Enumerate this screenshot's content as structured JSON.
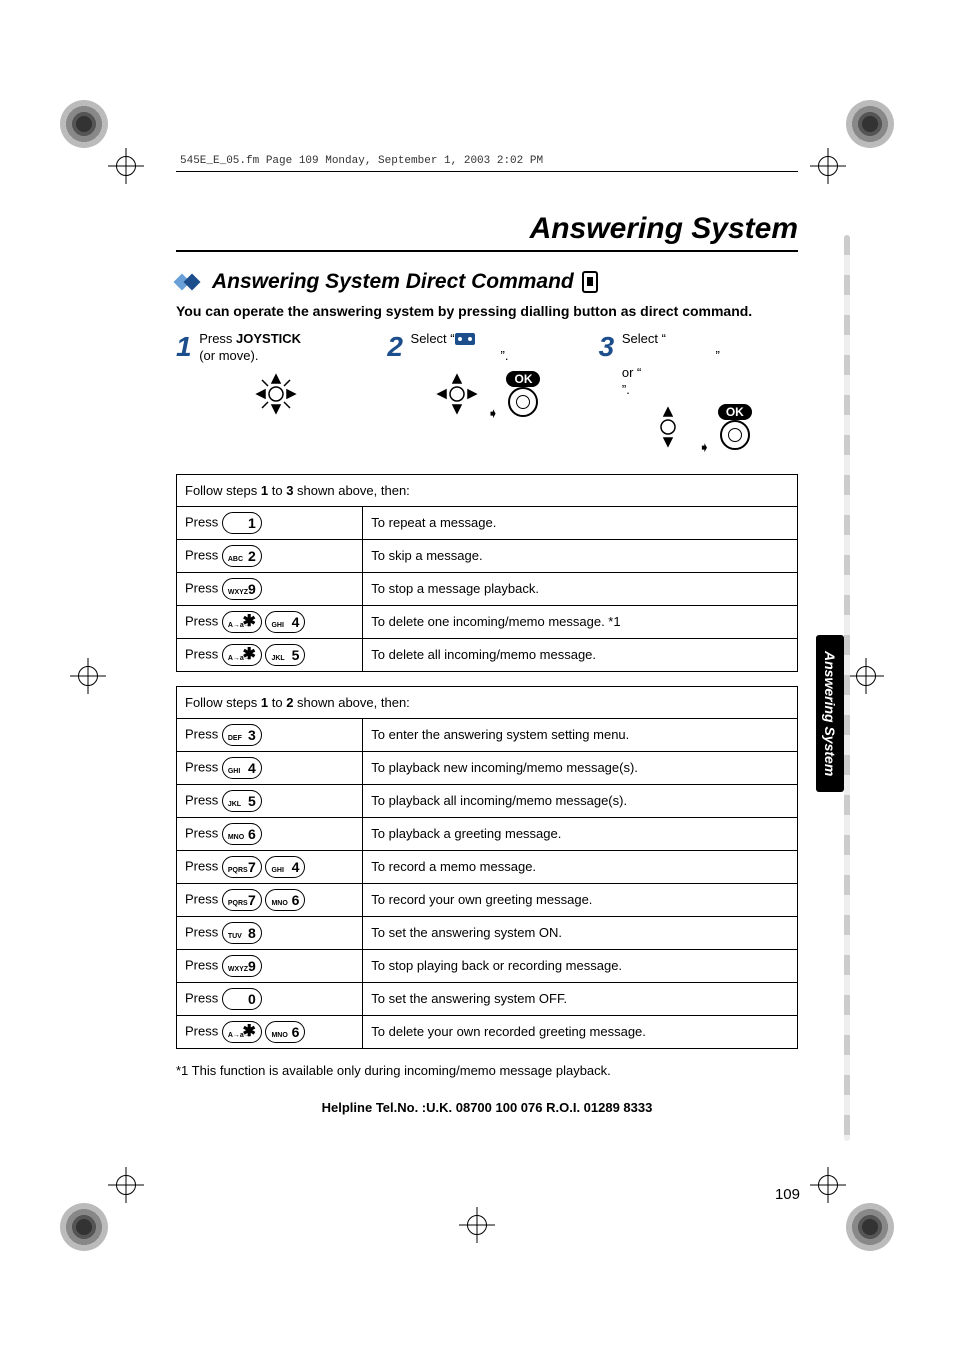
{
  "header_line": "545E_E_05.fm  Page 109  Monday, September 1, 2003  2:02 PM",
  "top_title": "Answering System",
  "section_title": "Answering System Direct Command",
  "intro": "You can operate the answering system by pressing dialling button as direct command.",
  "steps": {
    "s1_num": "1",
    "s1_text": "Press JOYSTICK (or move).",
    "s2_num": "2",
    "s2_prefix": "Select “",
    "s2_suffix": "”.",
    "s3_num": "3",
    "s3_line1_prefix": "Select “",
    "s3_line1_suffix": "”",
    "s3_line2_prefix": "or “",
    "s3_line2_suffix": "”.",
    "ok_label": "OK"
  },
  "table1": {
    "header_before": "Follow steps ",
    "header_b1": "1",
    "header_mid": " to ",
    "header_b2": "3",
    "header_after": " shown above, then:",
    "rows": [
      {
        "press": "Press",
        "keys": [
          {
            "sub": "",
            "num": "1"
          }
        ],
        "desc": "To repeat a message."
      },
      {
        "press": "Press",
        "keys": [
          {
            "sub": "ABC",
            "num": "2"
          }
        ],
        "desc": "To skip a message."
      },
      {
        "press": "Press",
        "keys": [
          {
            "sub": "WXYZ",
            "num": "9"
          }
        ],
        "desc": "To stop a message playback."
      },
      {
        "press": "Press",
        "keys": [
          {
            "sub": "A→a→",
            "num": "✱"
          },
          {
            "sub": "GHI",
            "num": "4"
          }
        ],
        "desc": "To delete one incoming/memo message. *1"
      },
      {
        "press": "Press",
        "keys": [
          {
            "sub": "A→a→",
            "num": "✱"
          },
          {
            "sub": "JKL",
            "num": "5"
          }
        ],
        "desc": "To delete all incoming/memo message."
      }
    ]
  },
  "table2": {
    "header_before": "Follow steps ",
    "header_b1": "1",
    "header_mid": " to ",
    "header_b2": "2",
    "header_after": " shown above, then:",
    "rows": [
      {
        "press": "Press",
        "keys": [
          {
            "sub": "DEF",
            "num": "3"
          }
        ],
        "desc": "To enter the answering system setting menu."
      },
      {
        "press": "Press",
        "keys": [
          {
            "sub": "GHI",
            "num": "4"
          }
        ],
        "desc": "To playback new incoming/memo message(s)."
      },
      {
        "press": "Press",
        "keys": [
          {
            "sub": "JKL",
            "num": "5"
          }
        ],
        "desc": "To playback all incoming/memo message(s)."
      },
      {
        "press": "Press",
        "keys": [
          {
            "sub": "MNO",
            "num": "6"
          }
        ],
        "desc": "To playback a greeting message."
      },
      {
        "press": "Press",
        "keys": [
          {
            "sub": "PQRS",
            "num": "7"
          },
          {
            "sub": "GHI",
            "num": "4"
          }
        ],
        "desc": "To record a memo message."
      },
      {
        "press": "Press",
        "keys": [
          {
            "sub": "PQRS",
            "num": "7"
          },
          {
            "sub": "MNO",
            "num": "6"
          }
        ],
        "desc": "To record your own greeting message."
      },
      {
        "press": "Press",
        "keys": [
          {
            "sub": "TUV",
            "num": "8"
          }
        ],
        "desc": "To set the answering system ON."
      },
      {
        "press": "Press",
        "keys": [
          {
            "sub": "WXYZ",
            "num": "9"
          }
        ],
        "desc": "To stop playing back or recording message."
      },
      {
        "press": "Press",
        "keys": [
          {
            "sub": "",
            "num": "0"
          }
        ],
        "desc": "To set the answering system OFF."
      },
      {
        "press": "Press",
        "keys": [
          {
            "sub": "A→a→",
            "num": "✱"
          },
          {
            "sub": "MNO",
            "num": "6"
          }
        ],
        "desc": "To delete your own recorded greeting message."
      }
    ]
  },
  "footnote": "*1 This function is available only during incoming/memo message playback.",
  "helpline": "Helpline Tel.No. :U.K. 08700 100 076  R.O.I. 01289 8333",
  "page_number": "109",
  "side_tab": "Answering System"
}
